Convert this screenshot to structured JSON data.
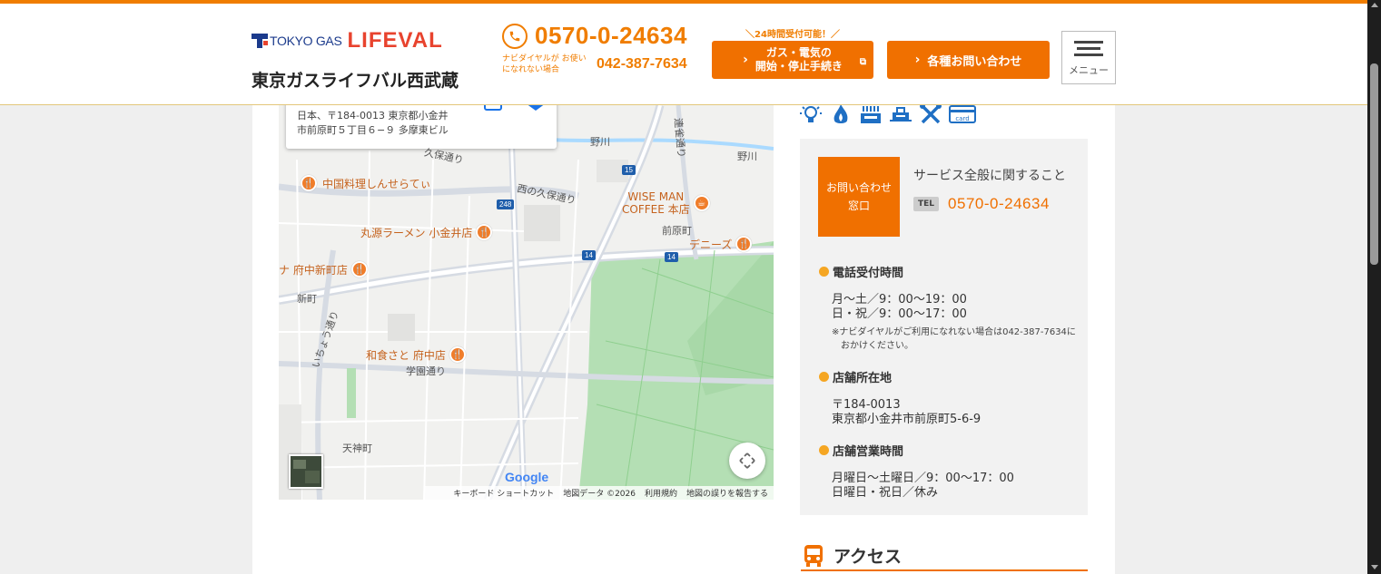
{
  "header": {
    "logo": {
      "brand_small": "TOKYO GAS",
      "brand_large": "LIFEVAL",
      "shop_name": "東京ガスライフバル西武蔵"
    },
    "tel": {
      "main": "0570-0-24634",
      "sub_note": "ナビダイヤルが お使いになれない場合",
      "sub_number": "042-387-7634"
    },
    "gas_button": {
      "note": "＼24時間受付可能！／",
      "line1": "ガス・電気の",
      "line2": "開始・停止手続き"
    },
    "inquiry_button": "各種お問い合わせ",
    "menu_label": "メニュー"
  },
  "map": {
    "address_line1": "日本、〒184-0013 東京都小金井",
    "address_line2": "市前原町５丁目６−９ 多摩東ビル",
    "pois": [
      "中国料理しんせらてぃ",
      "WISE MAN",
      "COFFEE 本店",
      "丸源ラーメン 小金井店",
      "デニーズ",
      "ナ 府中新町店",
      "和食さと 府中店"
    ],
    "roads": [
      "西の久保通り",
      "久保通り",
      "野川",
      "野川",
      "前原町",
      "新町",
      "いちょう通り",
      "学園通り",
      "天神町",
      "連雀通り"
    ],
    "route_shields": [
      "15",
      "248",
      "14",
      "14"
    ],
    "google": "Google",
    "footer": [
      "キーボード ショートカット",
      "地図データ ©2026",
      "利用規約",
      "地図の誤りを報告する"
    ],
    "colors": {
      "park": "#b4dfb4",
      "road": "#ffffff",
      "major_road": "#d6dbe3",
      "river": "#aadaff"
    }
  },
  "service_icons": [
    "lightbulb-icon",
    "flame-icon",
    "stove-icon",
    "water-heater-icon",
    "tools-icon",
    "card-icon"
  ],
  "info": {
    "badge": "お問い合わせ窓口",
    "badge_line1": "お問い合わせ",
    "badge_line2": "窓口",
    "title": "サービス全般に関すること",
    "tel_label": "TEL",
    "tel": "0570-0-24634",
    "phone_hours": {
      "heading": "電話受付時間",
      "line1": "月〜土／9：00〜19：00",
      "line2": "日・祝／9：00〜17：00",
      "note": "※ナビダイヤルがご利用になれない場合は042-387-7634におかけください。"
    },
    "location": {
      "heading": "店舗所在地",
      "line1": "〒184-0013",
      "line2": "東京都小金井市前原町5-6-9"
    },
    "business_hours": {
      "heading": "店舗営業時間",
      "line1": "月曜日〜土曜日／9：00〜17：00",
      "line2": "日曜日・祝日／休み"
    }
  },
  "access": {
    "title": "アクセス"
  },
  "theme": {
    "accent": "#f07000",
    "logo_blue": "#1b3a8c",
    "logo_red": "#e8432e",
    "icon_blue": "#1f6fc4"
  }
}
